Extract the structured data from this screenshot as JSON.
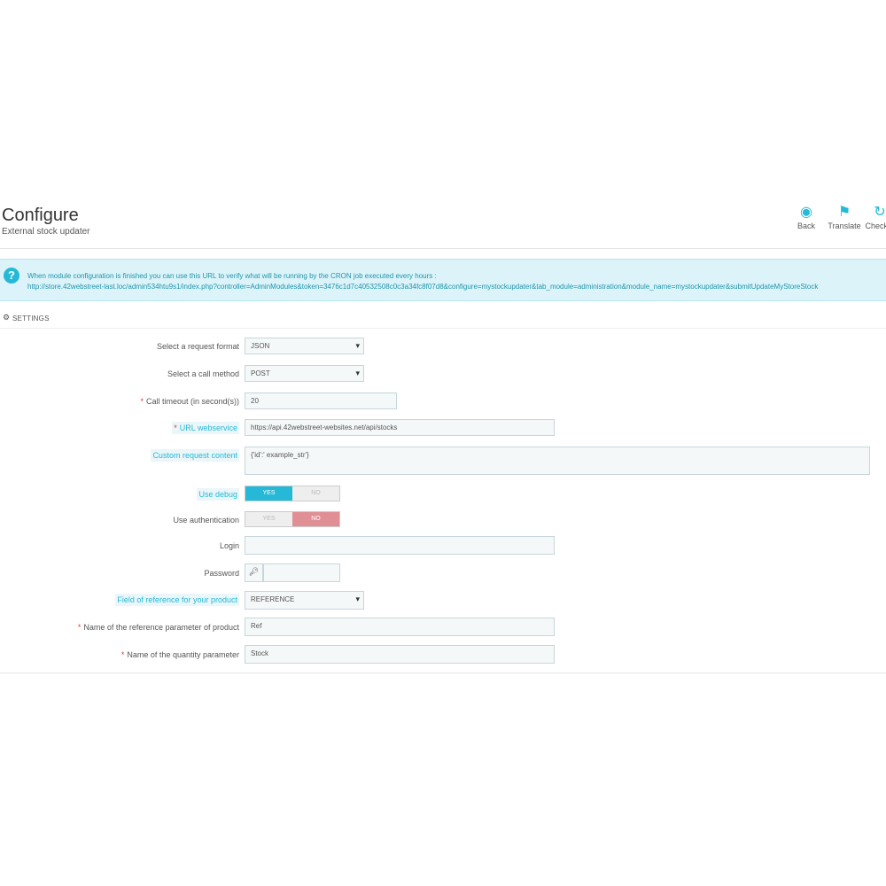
{
  "header": {
    "title": "Configure",
    "subtitle": "External stock updater",
    "toolbar": [
      {
        "label": "Back",
        "icon": "back-icon"
      },
      {
        "label": "Translate",
        "icon": "flag-icon"
      },
      {
        "label": "Check u",
        "icon": "refresh-icon"
      }
    ]
  },
  "alert": {
    "icon": "question-icon",
    "line1": "When module configuration is finished you can use this URL to verify what will be running by the CRON job executed every hours :",
    "line2": "http://store.42webstreet-last.loc/admin534htu9s1/index.php?controller=AdminModules&token=3476c1d7c40532508c0c3a34fc8f07d8&configure=mystockupdater&tab_module=administration&module_name=mystockupdater&submitUpdateMyStoreStock"
  },
  "settings": {
    "heading": "SETTINGS",
    "request_format": {
      "label": "Select a request format",
      "value": "JSON"
    },
    "call_method": {
      "label": "Select a call method",
      "value": "POST"
    },
    "call_timeout": {
      "label": "Call timeout (in second(s))",
      "value": "20"
    },
    "url_webservice": {
      "label": "URL webservice",
      "value": "https://api.42webstreet-websites.net/api/stocks"
    },
    "custom_request": {
      "label": "Custom request content",
      "value": "{'id':' example_str'}"
    },
    "use_debug": {
      "label": "Use debug",
      "yes": "YES",
      "no": "NO",
      "selected": "YES"
    },
    "use_auth": {
      "label": "Use authentication",
      "yes": "YES",
      "no": "NO",
      "selected": "NO"
    },
    "login": {
      "label": "Login",
      "value": ""
    },
    "password": {
      "label": "Password",
      "value": "",
      "icon": "key-icon"
    },
    "reference_field": {
      "label": "Field of reference for your product",
      "value": "REFERENCE"
    },
    "reference_param": {
      "label": "Name of the reference parameter of product",
      "value": "Ref"
    },
    "quantity_param": {
      "label": "Name of the quantity parameter",
      "value": "Stock"
    }
  },
  "colors": {
    "accent": "#25b9d7",
    "danger": "#e08f95",
    "required": "#e3343c"
  }
}
